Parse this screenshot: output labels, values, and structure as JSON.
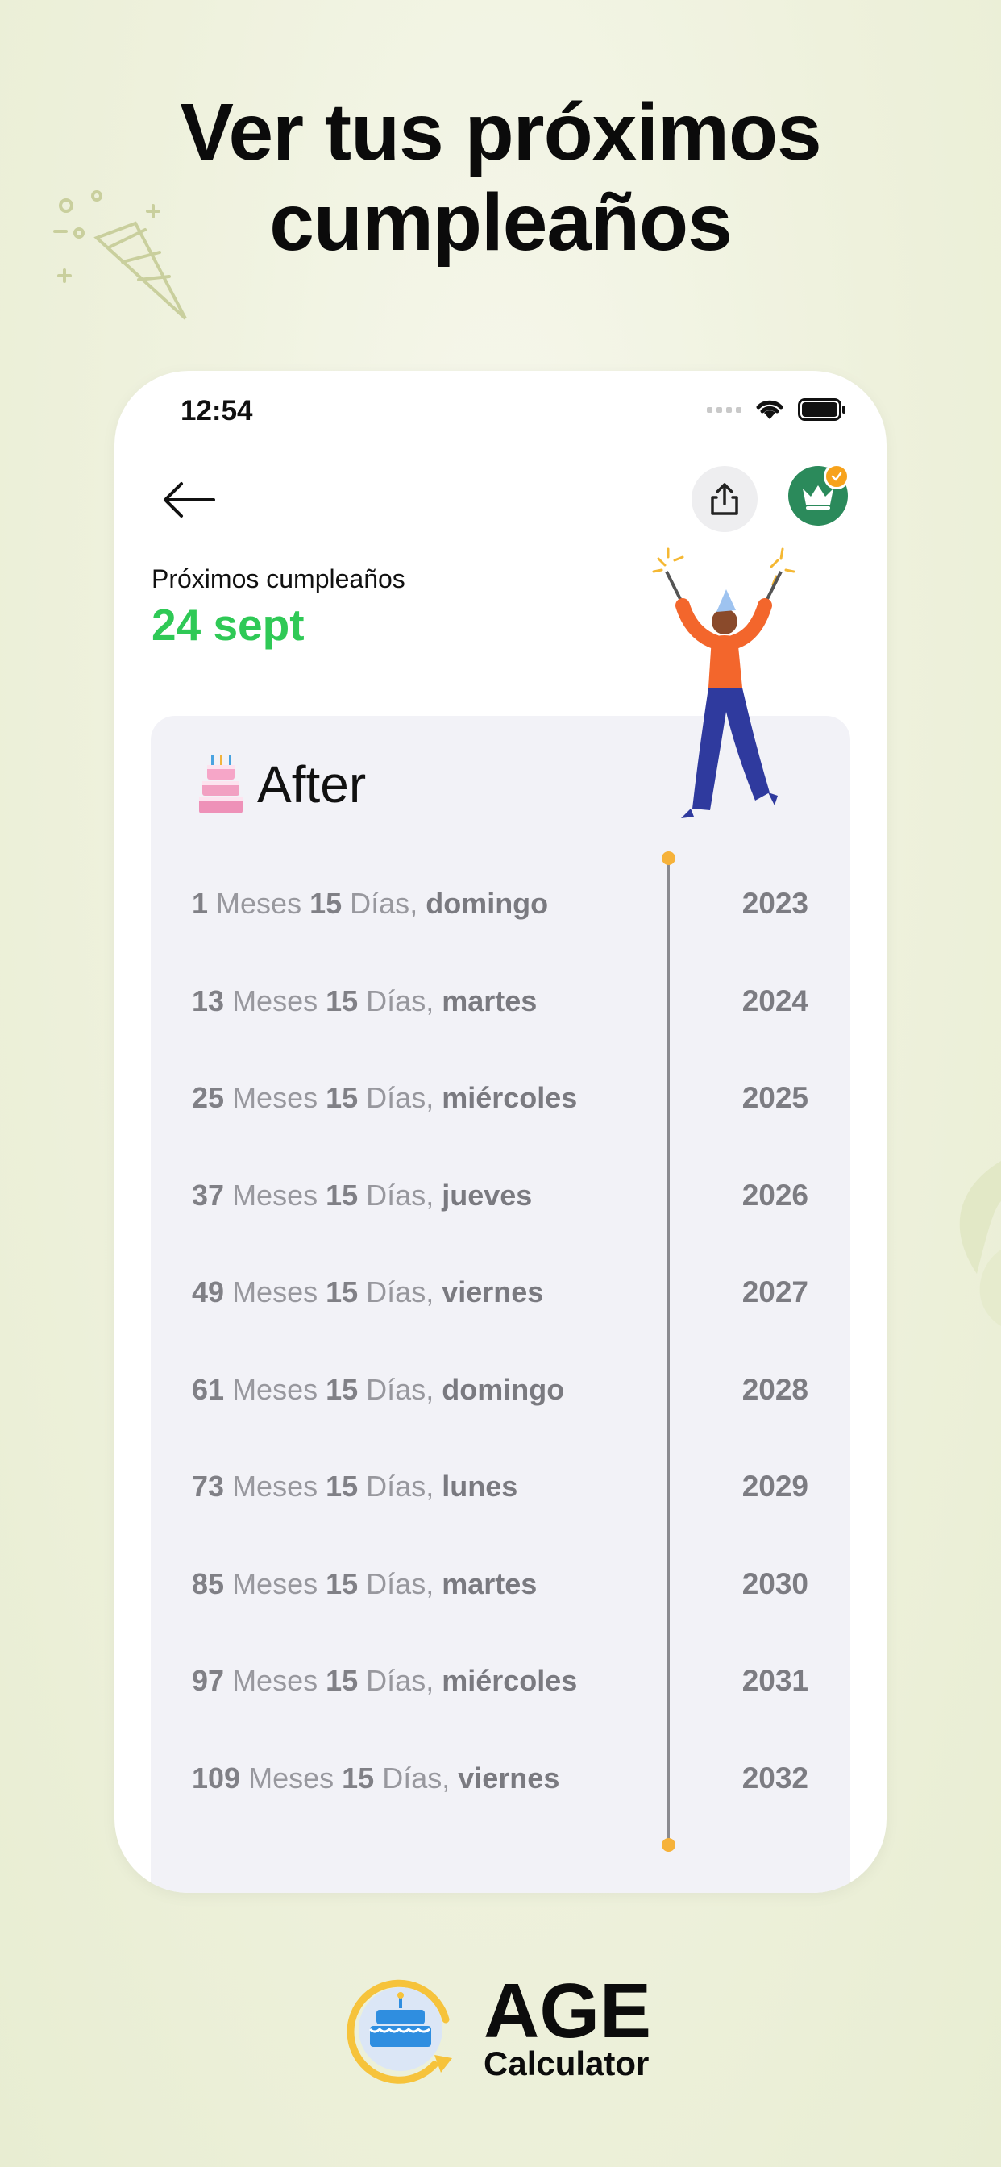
{
  "headline": {
    "line1": "Ver tus próximos",
    "line2": "cumpleaños"
  },
  "status": {
    "time": "12:54"
  },
  "header": {
    "next_label": "Próximos cumpleaños",
    "next_date": "24 sept"
  },
  "card": {
    "emoji": "🎂",
    "title": "After",
    "rows": [
      {
        "months": "1",
        "days": "15",
        "weekday": "domingo",
        "year": "2023"
      },
      {
        "months": "13",
        "days": "15",
        "weekday": "martes",
        "year": "2024"
      },
      {
        "months": "25",
        "days": "15",
        "weekday": "miércoles",
        "year": "2025"
      },
      {
        "months": "37",
        "days": "15",
        "weekday": "jueves",
        "year": "2026"
      },
      {
        "months": "49",
        "days": "15",
        "weekday": "viernes",
        "year": "2027"
      },
      {
        "months": "61",
        "days": "15",
        "weekday": "domingo",
        "year": "2028"
      },
      {
        "months": "73",
        "days": "15",
        "weekday": "lunes",
        "year": "2029"
      },
      {
        "months": "85",
        "days": "15",
        "weekday": "martes",
        "year": "2030"
      },
      {
        "months": "97",
        "days": "15",
        "weekday": "miércoles",
        "year": "2031"
      },
      {
        "months": "109",
        "days": "15",
        "weekday": "viernes",
        "year": "2032"
      }
    ],
    "unit_months": "Meses",
    "unit_days": "Días"
  },
  "brand": {
    "name": "AGE",
    "subtitle": "Calculator"
  },
  "colors": {
    "accent_green": "#2fc956",
    "premium_green": "#2b8a5b",
    "timeline_dot": "#f6b23a",
    "card_bg": "#f2f2f7"
  },
  "icons": [
    "back-arrow-icon",
    "share-icon",
    "crown-icon",
    "check-icon",
    "wifi-icon",
    "battery-icon",
    "birthday-cake-icon",
    "party-hat-icon"
  ]
}
